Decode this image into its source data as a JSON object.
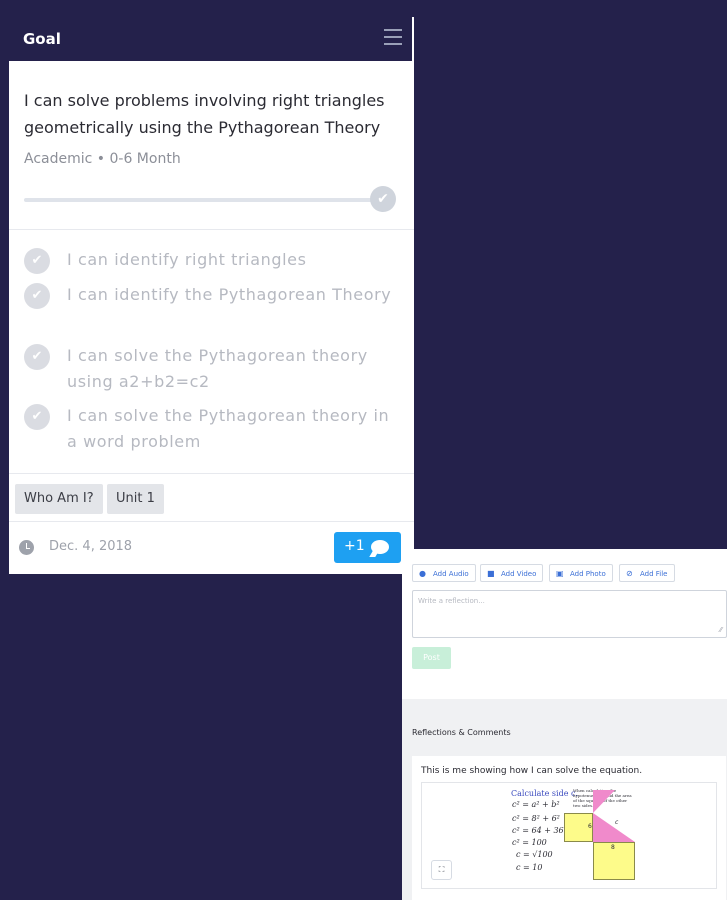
{
  "goal_panel": {
    "header_title": "Goal",
    "goal_statement": "I can solve problems involving right triangles geometrically using the Pythagorean Theory",
    "meta": "Academic • 0-6 Month",
    "progress_percent": 100,
    "objectives": [
      {
        "text": "I can identify right triangles",
        "completed": true
      },
      {
        "text": "I can identify the Pythagorean Theory",
        "completed": true
      },
      {
        "text": "I can solve the Pythagorean theory using a2+b2=c2",
        "completed": true
      },
      {
        "text": "I can solve the Pythagorean theory in a word problem",
        "completed": true
      }
    ],
    "tags": [
      "Who Am I?",
      "Unit 1"
    ],
    "date": "Dec. 4, 2018",
    "plus_one_label": "+1"
  },
  "reflection_panel": {
    "buttons": {
      "audio": "Add Audio",
      "video": "Add Video",
      "photo": "Add Photo",
      "file": "Add File"
    },
    "input_placeholder": "Write a reflection...",
    "post_label": "Post",
    "section_title": "Reflections & Comments",
    "comment_text": "This is me showing how I can solve the equation.",
    "image_content": {
      "heading": "Calculate side c.",
      "note": "When calculating the hypotenuse, we add the area of the squares of the other two sides.",
      "lines": [
        "c² = a² + b²",
        "c² = 8² + 6²",
        "c² = 64 + 36",
        "c² = 100",
        "c = √100",
        "c = 10"
      ],
      "label_a": "6",
      "label_b": "8",
      "label_c": "c"
    }
  },
  "colors": {
    "background": "#24214b",
    "accent_blue": "#1ea0f2",
    "post_button": "#c8efd9"
  }
}
